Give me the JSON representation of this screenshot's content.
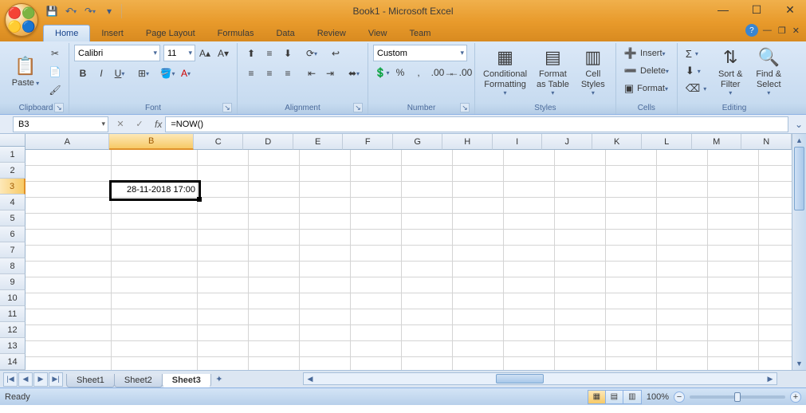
{
  "title": "Book1 - Microsoft Excel",
  "tabs": [
    "Home",
    "Insert",
    "Page Layout",
    "Formulas",
    "Data",
    "Review",
    "View",
    "Team"
  ],
  "activeTab": "Home",
  "ribbon": {
    "clipboard": {
      "label": "Clipboard",
      "paste": "Paste"
    },
    "font": {
      "label": "Font",
      "name": "Calibri",
      "size": "11"
    },
    "alignment": {
      "label": "Alignment"
    },
    "number": {
      "label": "Number",
      "format": "Custom"
    },
    "styles": {
      "label": "Styles",
      "cond": "Conditional\nFormatting",
      "table": "Format\nas Table",
      "cell": "Cell\nStyles"
    },
    "cells": {
      "label": "Cells",
      "insert": "Insert",
      "delete": "Delete",
      "format": "Format"
    },
    "editing": {
      "label": "Editing",
      "sort": "Sort &\nFilter",
      "find": "Find &\nSelect"
    }
  },
  "nameBox": "B3",
  "formula": "=NOW()",
  "columns": [
    "A",
    "B",
    "C",
    "D",
    "E",
    "F",
    "G",
    "H",
    "I",
    "J",
    "K",
    "L",
    "M",
    "N"
  ],
  "selectedCol": "B",
  "rows": [
    1,
    2,
    3,
    4,
    5,
    6,
    7,
    8,
    9,
    10,
    11,
    12,
    13,
    14
  ],
  "selectedRow": 3,
  "cellValue": "28-11-2018 17:00",
  "sheets": [
    "Sheet1",
    "Sheet2",
    "Sheet3"
  ],
  "activeSheet": "Sheet3",
  "status": {
    "ready": "Ready",
    "zoom": "100%"
  }
}
